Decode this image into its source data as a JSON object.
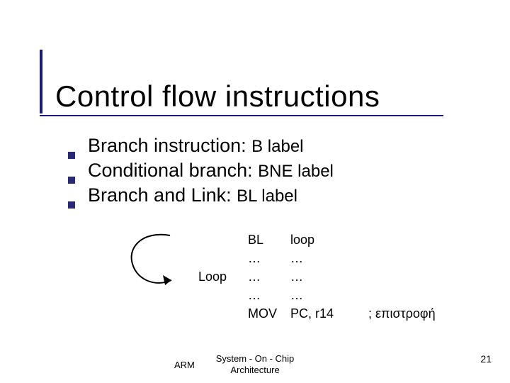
{
  "title": "Control flow instructions",
  "bullets": [
    {
      "text": "Branch instruction: ",
      "code": "B label"
    },
    {
      "text": "Conditional branch: ",
      "code": "BNE label"
    },
    {
      "text": "Branch and Link:  ",
      "code": "BL label"
    }
  ],
  "code": {
    "rows": [
      {
        "label": "",
        "a": "BL",
        "b": "loop",
        "c": ""
      },
      {
        "label": "",
        "a": "…",
        "b": "…",
        "c": ""
      },
      {
        "label": "Loop",
        "a": "…",
        "b": "…",
        "c": ""
      },
      {
        "label": "",
        "a": "…",
        "b": "…",
        "c": ""
      },
      {
        "label": "",
        "a": "MOV",
        "b": "PC, r14",
        "c": "; επιστροφή"
      }
    ]
  },
  "footer": {
    "left": "ARM",
    "center_line1": "System - On - Chip",
    "center_line2": "Architecture",
    "page": "21"
  }
}
